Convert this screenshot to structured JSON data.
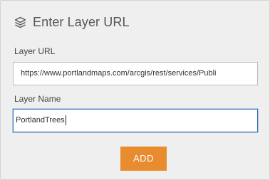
{
  "dialog": {
    "title": "Enter Layer URL",
    "icon": "layers-icon"
  },
  "layer_url": {
    "label": "Layer URL",
    "value": "https://www.portlandmaps.com/arcgis/rest/services/Publi"
  },
  "layer_name": {
    "label": "Layer Name",
    "value": "PortlandTrees"
  },
  "add_button": {
    "label": "ADD",
    "color": "#e98b2f"
  }
}
